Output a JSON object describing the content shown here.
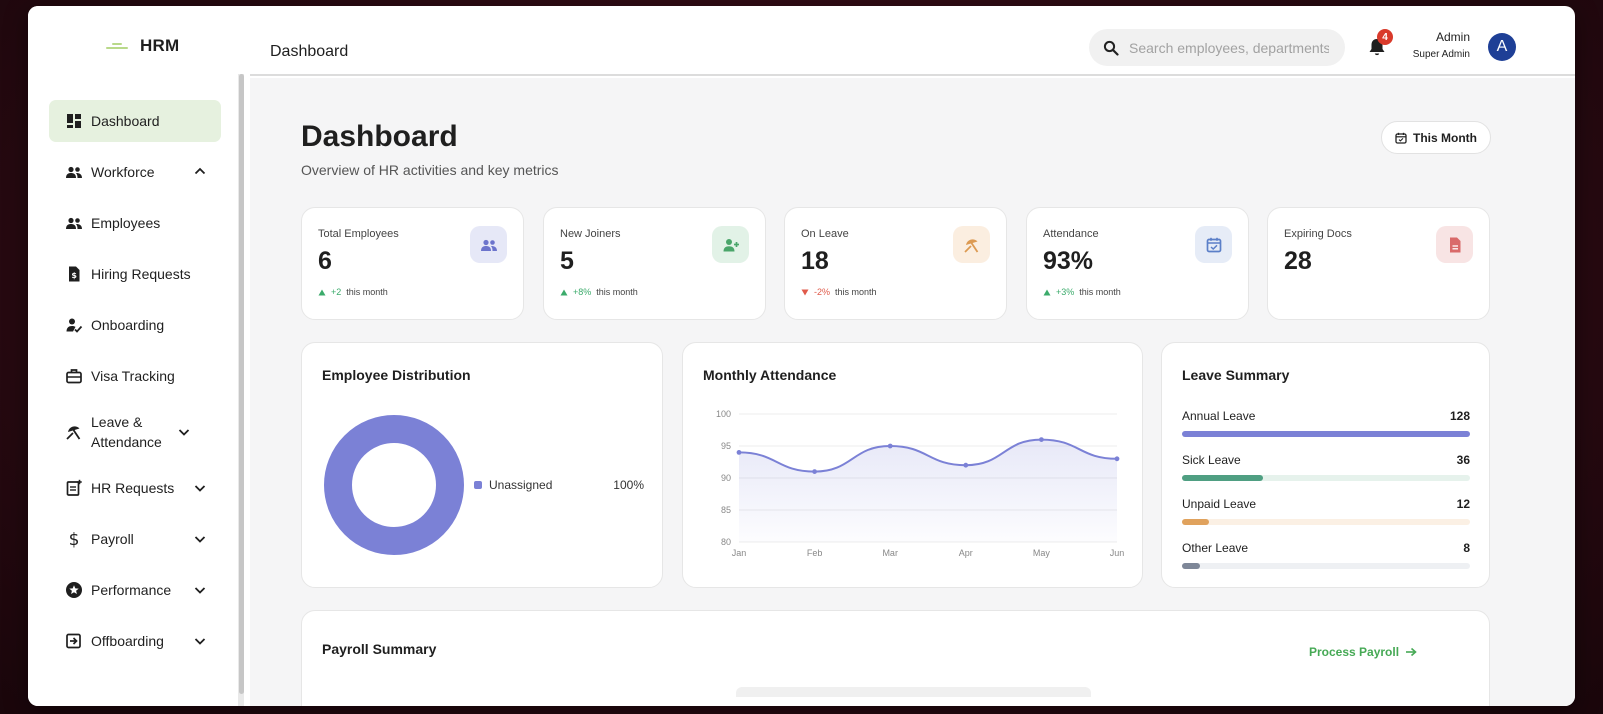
{
  "app": {
    "brand": "HRM"
  },
  "sidebar": {
    "items": [
      {
        "label": "Dashboard",
        "icon": "dashboard-icon",
        "active": true,
        "chevron": null
      },
      {
        "label": "Workforce",
        "icon": "people-icon",
        "chevron": "up"
      },
      {
        "label": "Employees",
        "icon": "people-icon",
        "chevron": null
      },
      {
        "label": "Hiring Requests",
        "icon": "dollar-document-icon",
        "chevron": null
      },
      {
        "label": "Onboarding",
        "icon": "person-check-icon",
        "chevron": null
      },
      {
        "label": "Visa Tracking",
        "icon": "briefcase-icon",
        "chevron": null
      },
      {
        "label": "Leave & Attendance",
        "icon": "beach-umbrella-icon",
        "chevron": "down"
      },
      {
        "label": "HR Requests",
        "icon": "document-add-icon",
        "chevron": "down"
      },
      {
        "label": "Payroll",
        "icon": "dollar-icon",
        "chevron": "down"
      },
      {
        "label": "Performance",
        "icon": "star-circle-icon",
        "chevron": "down"
      },
      {
        "label": "Offboarding",
        "icon": "exit-icon",
        "chevron": "down"
      }
    ]
  },
  "header": {
    "title": "Dashboard",
    "search_placeholder": "Search employees, departments",
    "notification_count": "4",
    "user_name": "Admin",
    "user_role": "Super Admin",
    "avatar_initial": "A"
  },
  "page": {
    "title": "Dashboard",
    "subtitle": "Overview of HR activities and key metrics",
    "period_button": "This Month"
  },
  "stats": [
    {
      "label": "Total Employees",
      "value": "6",
      "delta": "+2",
      "direction": "up",
      "period": "this month",
      "icon": "people-icon",
      "icon_bg": "#e6e8f7",
      "icon_color": "#6c74cc"
    },
    {
      "label": "New Joiners",
      "value": "5",
      "delta": "+8%",
      "direction": "up",
      "period": "this month",
      "icon": "person-add-icon",
      "icon_bg": "#e2f2e7",
      "icon_color": "#4aa56a"
    },
    {
      "label": "On Leave",
      "value": "18",
      "delta": "-2%",
      "direction": "down",
      "period": "this month",
      "icon": "beach-umbrella-icon",
      "icon_bg": "#fbeee0",
      "icon_color": "#dc9a52"
    },
    {
      "label": "Attendance",
      "value": "93%",
      "delta": "+3%",
      "direction": "up",
      "period": "this month",
      "icon": "calendar-check-icon",
      "icon_bg": "#e6ecf7",
      "icon_color": "#5b7fc8"
    },
    {
      "label": "Expiring Docs",
      "value": "28",
      "delta": "",
      "direction": "",
      "period": "",
      "icon": "document-icon",
      "icon_bg": "#f8e4e4",
      "icon_color": "#d96a6a"
    }
  ],
  "distribution": {
    "title": "Employee Distribution",
    "legend": [
      {
        "label": "Unassigned",
        "percent": "100%",
        "color": "#7b81d6"
      }
    ]
  },
  "attendance_chart": {
    "title": "Monthly Attendance",
    "chart_data": {
      "type": "area",
      "title": "Monthly Attendance",
      "categories": [
        "Jan",
        "Feb",
        "Mar",
        "Apr",
        "May",
        "Jun"
      ],
      "values": [
        94,
        91,
        95,
        92,
        96,
        93
      ],
      "ylim": [
        80,
        100
      ],
      "yticks": [
        80,
        85,
        90,
        95,
        100
      ],
      "color": "#7b81d6",
      "grid": true
    }
  },
  "leave_summary": {
    "title": "Leave Summary",
    "max": 128,
    "items": [
      {
        "label": "Annual Leave",
        "count": "128",
        "value": 128,
        "color": "#7b81d6",
        "track": "#eceefa"
      },
      {
        "label": "Sick Leave",
        "count": "36",
        "value": 36,
        "color": "#4f9f82",
        "track": "#e6f2ec"
      },
      {
        "label": "Unpaid Leave",
        "count": "12",
        "value": 12,
        "color": "#e0a25d",
        "track": "#fbf0e4"
      },
      {
        "label": "Other Leave",
        "count": "8",
        "value": 8,
        "color": "#7e8798",
        "track": "#eef0f3"
      }
    ]
  },
  "payroll": {
    "title": "Payroll Summary",
    "action_label": "Process Payroll",
    "action_color": "#46a955"
  }
}
